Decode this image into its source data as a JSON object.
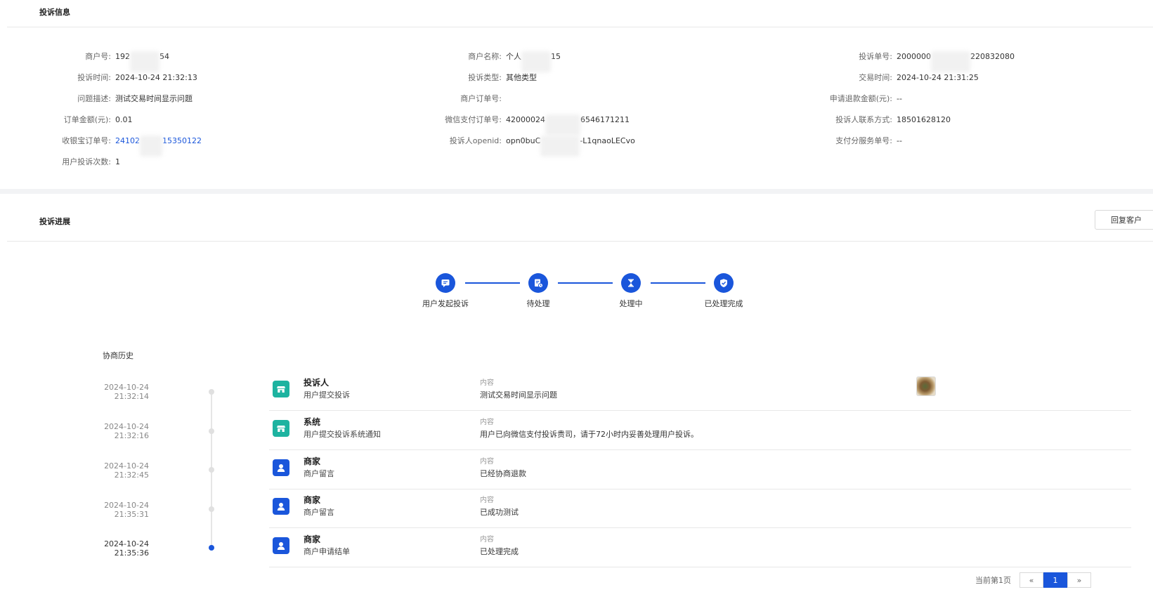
{
  "info_section": {
    "title": "投诉信息",
    "fields": [
      {
        "label": "商户号:",
        "value": "192",
        "value_tail": "54"
      },
      {
        "label": "投诉时间:",
        "value": "2024-10-24 21:32:13"
      },
      {
        "label": "问题描述:",
        "value": "测试交易时间显示问题"
      },
      {
        "label": "订单金额(元):",
        "value": "0.01"
      },
      {
        "label": "收银宝订单号:",
        "value": "24102",
        "value_tail": "15350122"
      },
      {
        "label": "用户投诉次数:",
        "value": "1"
      },
      {
        "label": "商户名称:",
        "value": "个人",
        "value_tail": "15"
      },
      {
        "label": "投诉类型:",
        "value": "其他类型"
      },
      {
        "label": "商户订单号:",
        "value": ""
      },
      {
        "label": "微信支付订单号:",
        "value": "42000024",
        "value_tail": "6546171211"
      },
      {
        "label": "投诉人openid:",
        "value": "opn0buC",
        "value_tail": "-L1qnaoLECvo"
      },
      {
        "label": "投诉单号:",
        "value": "2000000",
        "value_tail": "220832080"
      },
      {
        "label": "交易时间:",
        "value": "2024-10-24 21:31:25"
      },
      {
        "label": "申请退款金额(元):",
        "value": "--"
      },
      {
        "label": "投诉人联系方式:",
        "value": "18501628120"
      },
      {
        "label": "支付分服务单号:",
        "value": "--"
      }
    ]
  },
  "progress_section": {
    "title": "投诉进展",
    "reply_button": "回复客户",
    "steps": [
      {
        "label": "用户发起投诉",
        "icon": "message-icon"
      },
      {
        "label": "待处理",
        "icon": "pending-doc-icon"
      },
      {
        "label": "处理中",
        "icon": "hourglass-icon"
      },
      {
        "label": "已处理完成",
        "icon": "shield-check-icon"
      }
    ]
  },
  "history": {
    "title": "协商历史",
    "content_label": "内容",
    "records": [
      {
        "date": "2024-10-24",
        "time": "21:32:14",
        "who": "投诉人",
        "action": "用户提交投诉",
        "content": "测试交易时间显示问题",
        "icon": "store-icon",
        "icon_color": "#1db3a0",
        "has_image": true
      },
      {
        "date": "2024-10-24",
        "time": "21:32:16",
        "who": "系统",
        "action": "用户提交投诉系统通知",
        "content": "用户已向微信支付投诉贵司，请于72小时内妥善处理用户投诉。",
        "icon": "store-icon",
        "icon_color": "#1db3a0",
        "has_image": false
      },
      {
        "date": "2024-10-24",
        "time": "21:32:45",
        "who": "商家",
        "action": "商户留言",
        "content": "已经协商退款",
        "icon": "user-icon",
        "icon_color": "#1a56db",
        "has_image": false
      },
      {
        "date": "2024-10-24",
        "time": "21:35:31",
        "who": "商家",
        "action": "商户留言",
        "content": "已成功测试",
        "icon": "user-icon",
        "icon_color": "#1a56db",
        "has_image": false
      },
      {
        "date": "2024-10-24",
        "time": "21:35:36",
        "who": "商家",
        "action": "商户申请结单",
        "content": "已处理完成",
        "icon": "user-icon",
        "icon_color": "#1a56db",
        "has_image": false
      }
    ]
  },
  "pagination": {
    "info": "当前第1页",
    "prev": "«",
    "current": "1",
    "next": "»"
  },
  "colors": {
    "primary": "#1a56db",
    "teal": "#1db3a0",
    "divider": "#e8e8e8"
  }
}
